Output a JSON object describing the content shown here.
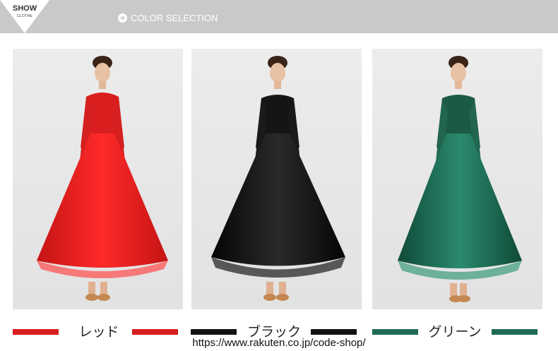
{
  "header": {
    "badge_title": "SHOW",
    "badge_subtitle": "CLOTHE",
    "section_title": "COLOR SELECTION",
    "arrow_icon": "arrow-right-circle-icon",
    "bar_color": "#c9c9c9"
  },
  "variants": [
    {
      "label": "レッド",
      "color": "#d81e1e"
    },
    {
      "label": "ブラック",
      "color": "#111111"
    },
    {
      "label": "グリーン",
      "color": "#1d6b55"
    }
  ],
  "footer": {
    "url": "https://www.rakuten.co.jp/code-shop/"
  }
}
